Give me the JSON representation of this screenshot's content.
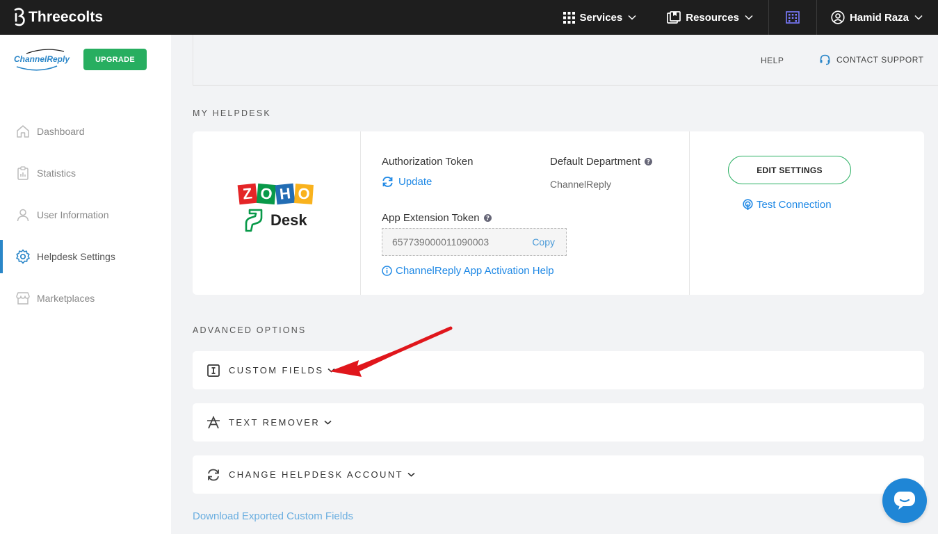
{
  "topbar": {
    "brand": "Threecolts",
    "nav": [
      {
        "label": "Services"
      },
      {
        "label": "Resources"
      }
    ],
    "user_name": "Hamid Raza"
  },
  "sidebar": {
    "logo_text": "ChannelReply",
    "upgrade_label": "UPGRADE",
    "items": [
      {
        "label": "Dashboard"
      },
      {
        "label": "Statistics"
      },
      {
        "label": "User Information"
      },
      {
        "label": "Helpdesk Settings"
      },
      {
        "label": "Marketplaces"
      }
    ],
    "active_index": 3
  },
  "header": {
    "help_label": "HELP",
    "support_label": "CONTACT SUPPORT"
  },
  "helpdesk": {
    "section_title": "MY HELPDESK",
    "logo_letters": [
      "Z",
      "O",
      "H",
      "O"
    ],
    "logo_colors": [
      "#e42527",
      "#089949",
      "#226db4",
      "#f9b21d"
    ],
    "logo_product": "Desk",
    "auth_token_label": "Authorization Token",
    "update_label": "Update",
    "default_dept_label": "Default Department",
    "default_dept_value": "ChannelReply",
    "app_ext_token_label": "App Extension Token",
    "app_ext_token_value": "657739000011090003",
    "copy_label": "Copy",
    "activation_help_label": "ChannelReply App Activation Help",
    "edit_settings_label": "EDIT SETTINGS",
    "test_connection_label": "Test Connection"
  },
  "advanced": {
    "section_title": "ADVANCED OPTIONS",
    "items": [
      {
        "label": "CUSTOM FIELDS"
      },
      {
        "label": "TEXT REMOVER"
      },
      {
        "label": "CHANGE HELPDESK ACCOUNT"
      }
    ],
    "download_label": "Download Exported Custom Fields"
  },
  "colors": {
    "accent_blue": "#1e88e5",
    "green": "#27ae60",
    "topbar": "#1e1e1e",
    "arrow_red": "#e0161c"
  }
}
